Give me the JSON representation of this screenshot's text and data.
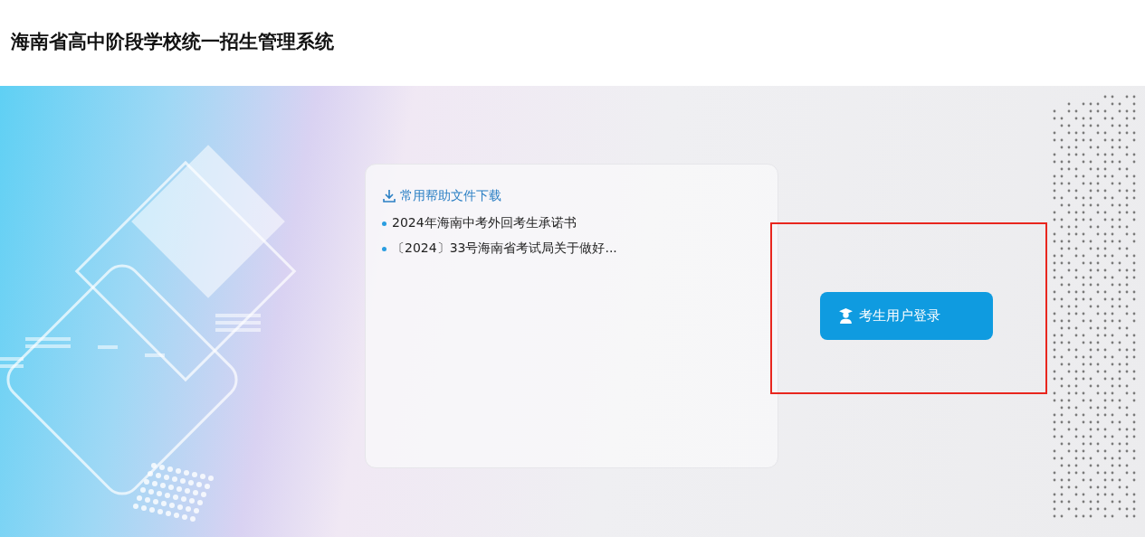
{
  "header": {
    "title": "海南省高中阶段学校统一招生管理系统"
  },
  "downloads": {
    "heading": "常用帮助文件下载",
    "items": [
      {
        "label": "2024年海南中考外回考生承诺书"
      },
      {
        "label": "〔2024〕33号海南省考试局关于做好..."
      }
    ]
  },
  "login_button": {
    "label": "考生用户登录"
  }
}
